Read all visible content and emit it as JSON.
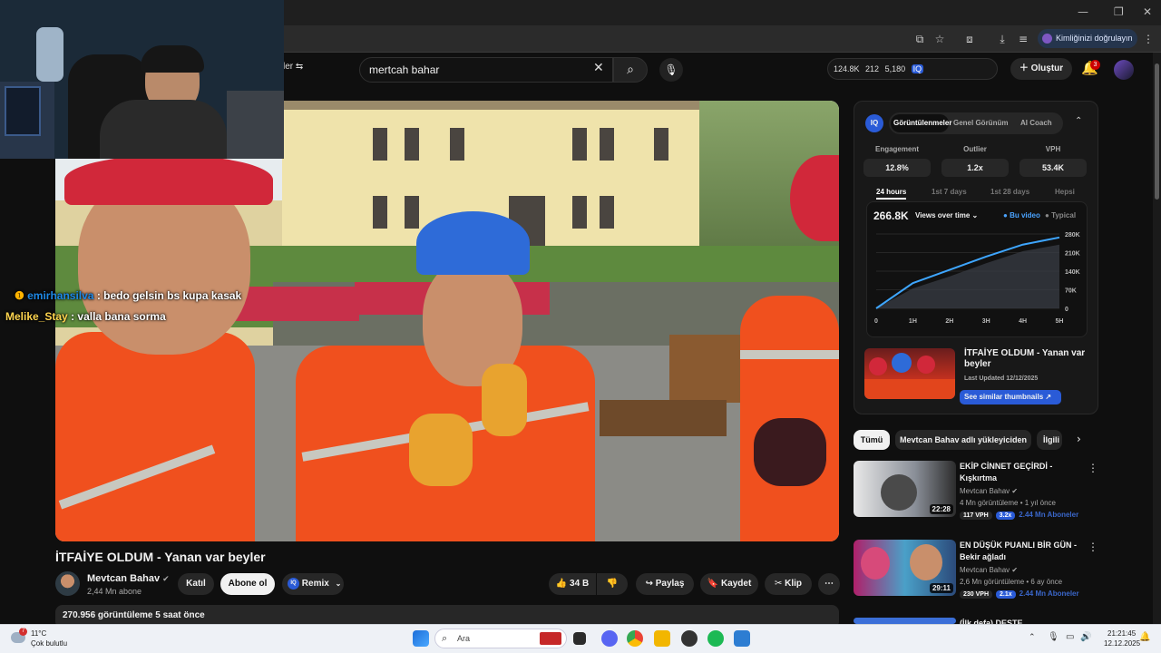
{
  "browser": {
    "verify_label": "Kimliğinizi doğrulayın",
    "window_controls": [
      "—",
      "❐",
      "✕"
    ]
  },
  "youtube_header": {
    "search_value": "mertcah bahar",
    "filter_fragment": "ler",
    "stats": [
      "124.8K",
      "212",
      "5,180"
    ],
    "create_label": "Oluştur",
    "notification_count": "3"
  },
  "video": {
    "title": "İTFAİYE OLDUM - Yanan var beyler",
    "views_line": "270.956 görüntüleme  5 saat önce"
  },
  "channel": {
    "name": "Mevtcan Bahav",
    "subs": "2,44 Mn abone",
    "join_label": "Katıl",
    "subscribe_label": "Abone ol",
    "remix_label": "Remix"
  },
  "actions": {
    "likes": "34 B",
    "share": "Paylaş",
    "save": "Kaydet",
    "clip": "Klip"
  },
  "chat": [
    {
      "user": "emirhansilva",
      "text": ": bedo gelsin bs kupa kasak",
      "user_color": "#1e88e5"
    },
    {
      "user": "Melike_Stay",
      "text": ": valla bana sorma",
      "user_color": "#ffd54f"
    }
  ],
  "panel": {
    "logo": "IQ",
    "tabs": [
      "Görüntülenmeler",
      "Genel Görünüm",
      "AI Coach"
    ],
    "metrics": [
      {
        "label": "Engagement",
        "value": "12.8%"
      },
      {
        "label": "Outlier",
        "value": "1.2x"
      },
      {
        "label": "VPH",
        "value": "53.4K"
      }
    ],
    "time_tabs": [
      "24 hours",
      "1st 7 days",
      "1st 28 days",
      "Hepsi"
    ],
    "total": "266.8K",
    "views_over_time": "Views over time",
    "legend_video": "Bu video",
    "legend_typical": "Typical",
    "thumb_title": "İTFAİYE OLDUM - Yanan var beyler",
    "last_updated": "Last Updated 12/12/2025",
    "similar_btn": "See similar thumbnails"
  },
  "chart_data": {
    "type": "line",
    "x": [
      "0",
      "1H",
      "2H",
      "3H",
      "4H",
      "5H"
    ],
    "y_ticks": [
      "280K",
      "210K",
      "140K",
      "70K",
      "0"
    ],
    "ylim": [
      0,
      280000
    ],
    "series": [
      {
        "name": "Bu video",
        "values": [
          0,
          95000,
          145000,
          195000,
          240000,
          267000
        ]
      },
      {
        "name": "Typical",
        "values": [
          0,
          75000,
          120000,
          170000,
          215000,
          240000
        ]
      }
    ]
  },
  "recommendations": {
    "chips": [
      "Tümü",
      "Mevtcan Bahav adlı yükleyiciden",
      "İlgili"
    ],
    "items": [
      {
        "title": "EKİP CİNNET GEÇİRDİ - Kışkırtma",
        "channel": "Mevtcan Bahav",
        "meta": "4 Mn görüntüleme • 1 yıl önce",
        "duration": "22:28",
        "vph": "117 VPH",
        "outlier": "3.2x",
        "subs": "2.44 Mn Aboneler"
      },
      {
        "title": "EN DÜŞÜK PUANLI BİR GÜN - Bekir ağladı",
        "channel": "Mevtcan Bahav",
        "meta": "2,6 Mn görüntüleme • 6 ay önce",
        "duration": "29:11",
        "vph": "230 VPH",
        "outlier": "2.1x",
        "subs": "2.44 Mn Aboneler"
      },
      {
        "title": "(İlk defa) DESTE",
        "channel": "",
        "meta": "",
        "duration": "",
        "vph": "",
        "outlier": "",
        "subs": ""
      }
    ]
  },
  "taskbar": {
    "temp": "11°C",
    "condition": "Çok bulutlu",
    "weather_badge": "7",
    "search_placeholder": "Ara",
    "time": "21:21:45",
    "date": "12.12.2025"
  }
}
